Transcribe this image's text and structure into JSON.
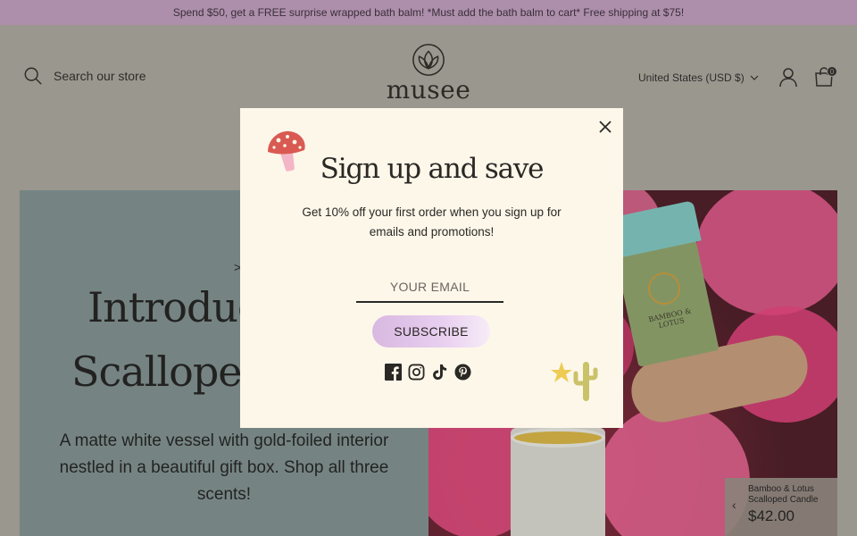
{
  "announcement": "Spend $50, get a FREE surprise wrapped bath balm! *Must add the bath balm to cart* Free shipping at $75!",
  "header": {
    "search_placeholder": "Search our store",
    "logo_text": "musee",
    "currency": "United States (USD $)",
    "cart_count": "0"
  },
  "hero": {
    "eyebrow": ">",
    "title_line1": "Introduci",
    "title_line2": "Scalloped",
    "description": "A matte white vessel with gold-foiled interior nestled in a beautiful gift box. Shop all three scents!",
    "box_text": "BAMBOO & LOTUS"
  },
  "product_card": {
    "name": "Bamboo & Lotus Scalloped Candle",
    "price": "$42.00"
  },
  "modal": {
    "title": "Sign up and save",
    "description": "Get 10% off your first order when you sign up for emails and promotions!",
    "email_placeholder": "YOUR EMAIL",
    "subscribe_label": "SUBSCRIBE",
    "socials": [
      "facebook-icon",
      "instagram-icon",
      "tiktok-icon",
      "pinterest-icon"
    ]
  },
  "colors": {
    "announcement_bg": "#ad8fab",
    "header_bg": "#a8a49c",
    "modal_bg": "#fdf7ea",
    "hero_left_bg": "#7e8f8f",
    "subscribe_gradient_start": "#d8b8e0"
  }
}
